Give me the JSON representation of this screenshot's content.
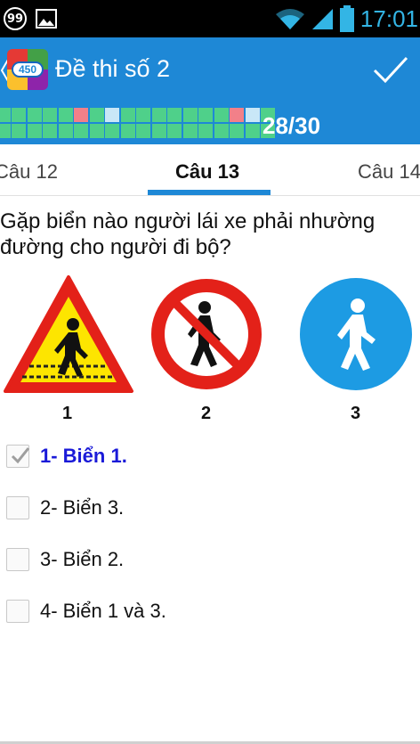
{
  "status_bar": {
    "notification_count": "99",
    "time": "17:01",
    "icons": [
      "notification-count-icon",
      "image-icon",
      "wifi-icon",
      "signal-icon",
      "battery-icon"
    ]
  },
  "action_bar": {
    "title": "Đề thi số 2",
    "app_icon_text": "450",
    "confirm_icon": "check-icon"
  },
  "progress": {
    "text": "28/30",
    "cells": [
      "done",
      "done",
      "done",
      "done",
      "done",
      "wrong",
      "done",
      "current",
      "done",
      "done",
      "done",
      "done",
      "done",
      "done",
      "done",
      "wrong",
      "current",
      "done",
      "done",
      "done",
      "done",
      "done",
      "done",
      "done",
      "done",
      "done",
      "done",
      "done",
      "done",
      "done",
      "done",
      "done",
      "done",
      "done",
      "done",
      "done"
    ]
  },
  "tabs": [
    {
      "label": "Câu 12",
      "active": false
    },
    {
      "label": "Câu 13",
      "active": true
    },
    {
      "label": "Câu 14",
      "active": false
    }
  ],
  "question": {
    "text": "Gặp biển nào người lái xe phải nhường đường cho người đi bộ?",
    "sign_labels": [
      "1",
      "2",
      "3"
    ]
  },
  "answers": [
    {
      "text": "1- Biển 1.",
      "checked": true
    },
    {
      "text": "2- Biển 3.",
      "checked": false
    },
    {
      "text": "3- Biển 2.",
      "checked": false
    },
    {
      "text": "4- Biển 1 và 3.",
      "checked": false
    }
  ],
  "colors": {
    "primary": "#1e88d6",
    "selected_answer": "#1a1ad8",
    "progress_done": "#4fd08a",
    "progress_wrong": "#f28089",
    "progress_current": "#c9e7f7"
  }
}
